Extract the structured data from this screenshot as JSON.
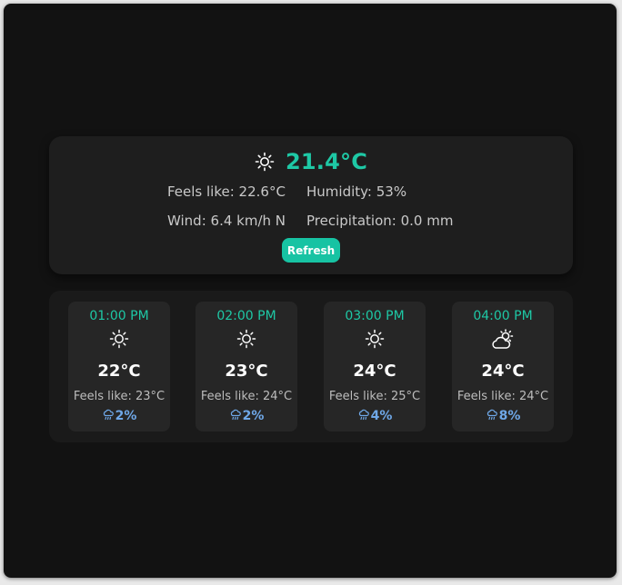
{
  "current": {
    "icon": "sun-icon",
    "temperature": "21.4°C",
    "feels_like": "Feels like: 22.6°C",
    "humidity": "Humidity: 53%",
    "wind": "Wind: 6.4 km/h N",
    "precipitation": "Precipitation: 0.0 mm",
    "refresh_label": "Refresh"
  },
  "forecast": [
    {
      "time": "01:00 PM",
      "icon": "sun-icon",
      "temp": "22°C",
      "feels": "Feels like: 23°C",
      "precip": "2%"
    },
    {
      "time": "02:00 PM",
      "icon": "sun-icon",
      "temp": "23°C",
      "feels": "Feels like: 24°C",
      "precip": "2%"
    },
    {
      "time": "03:00 PM",
      "icon": "sun-icon",
      "temp": "24°C",
      "feels": "Feels like: 25°C",
      "precip": "4%"
    },
    {
      "time": "04:00 PM",
      "icon": "partly-cloudy-icon",
      "temp": "24°C",
      "feels": "Feels like: 24°C",
      "precip": "8%"
    }
  ],
  "colors": {
    "accent": "#1ec8a5",
    "button": "#17c3a3",
    "precip": "#6fa8e8",
    "background": "#121212",
    "card": "#1e1e1e"
  }
}
